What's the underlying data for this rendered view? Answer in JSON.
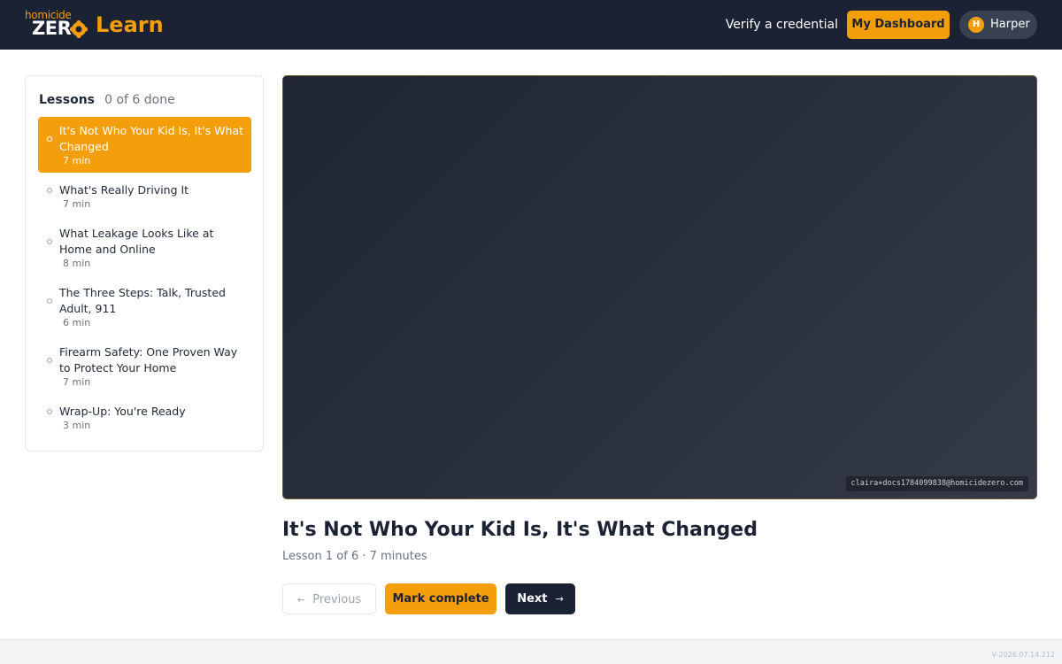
{
  "header": {
    "brand_small": "homicide",
    "brand_zero": "ZER",
    "brand_learn": "Learn",
    "verify_link": "Verify a credential",
    "dashboard_button": "My Dashboard",
    "user": {
      "initial": "H",
      "name": "Harper"
    },
    "accent_color": "#f59e0b",
    "bg_color": "#1a2233"
  },
  "sidebar": {
    "title": "Lessons",
    "progress": "0 of 6 done",
    "lessons": [
      {
        "title": "It's Not Who Your Kid Is, It's What Changed",
        "duration": "7 min",
        "active": true
      },
      {
        "title": "What's Really Driving It",
        "duration": "7 min",
        "active": false
      },
      {
        "title": "What Leakage Looks Like at Home and Online",
        "duration": "8 min",
        "active": false
      },
      {
        "title": "The Three Steps: Talk, Trusted Adult, 911",
        "duration": "6 min",
        "active": false
      },
      {
        "title": "Firearm Safety: One Proven Way to Protect Your Home",
        "duration": "7 min",
        "active": false
      },
      {
        "title": "Wrap-Up: You're Ready",
        "duration": "3 min",
        "active": false
      }
    ]
  },
  "main": {
    "video_watermark": "claira+docs1784099838@homicidezero.com",
    "lesson_title": "It's Not Who Your Kid Is, It's What Changed",
    "lesson_meta": "Lesson 1 of 6 · 7 minutes",
    "buttons": {
      "previous": "Previous",
      "mark_complete": "Mark complete",
      "next": "Next"
    }
  },
  "footer": {
    "version": "V-2026.07.14.212"
  }
}
